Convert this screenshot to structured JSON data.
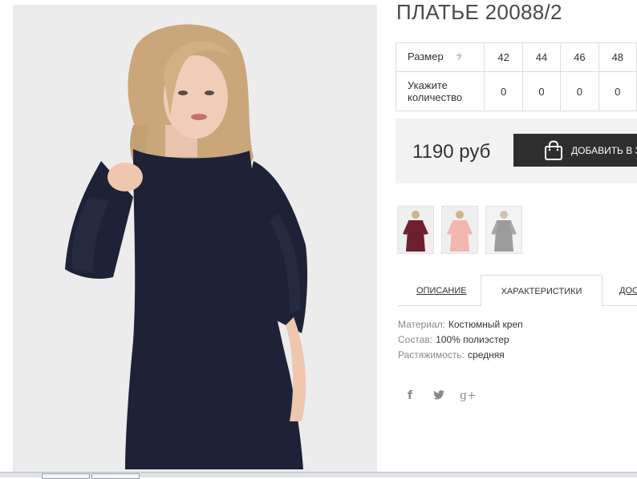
{
  "product": {
    "title": "ПЛАТЬЕ 20088/2"
  },
  "size_table": {
    "size_label": "Размер",
    "help": "?",
    "sizes": [
      "42",
      "44",
      "46",
      "48"
    ],
    "quantity_label": "Укажите количество",
    "quantities": [
      "0",
      "0",
      "0",
      "0"
    ]
  },
  "purchase": {
    "price": "1190 руб",
    "add_to_cart": "ДОБАВИТЬ В ЗАКАЗ"
  },
  "thumbnails": [
    {
      "color": "#6e1f2e"
    },
    {
      "color": "#f0b8ae"
    },
    {
      "color": "#9c9c9c"
    }
  ],
  "tabs": [
    {
      "label": "ОПИСАНИЕ"
    },
    {
      "label": "ХАРАКТЕРИСТИКИ"
    },
    {
      "label": "ДОСТАВКА"
    }
  ],
  "specs": [
    {
      "key": "Материал:",
      "value": "Костюмный креп"
    },
    {
      "key": "Состав:",
      "value": "100% полиэстер"
    },
    {
      "key": "Растяжимость:",
      "value": "средняя"
    }
  ],
  "social": {
    "facebook": "f",
    "twitter": "🐦",
    "googleplus": "g+"
  },
  "colors": {
    "dress": "#1f2236",
    "button_bg": "#2e2e2e",
    "price_bg": "#f2f2f2"
  }
}
